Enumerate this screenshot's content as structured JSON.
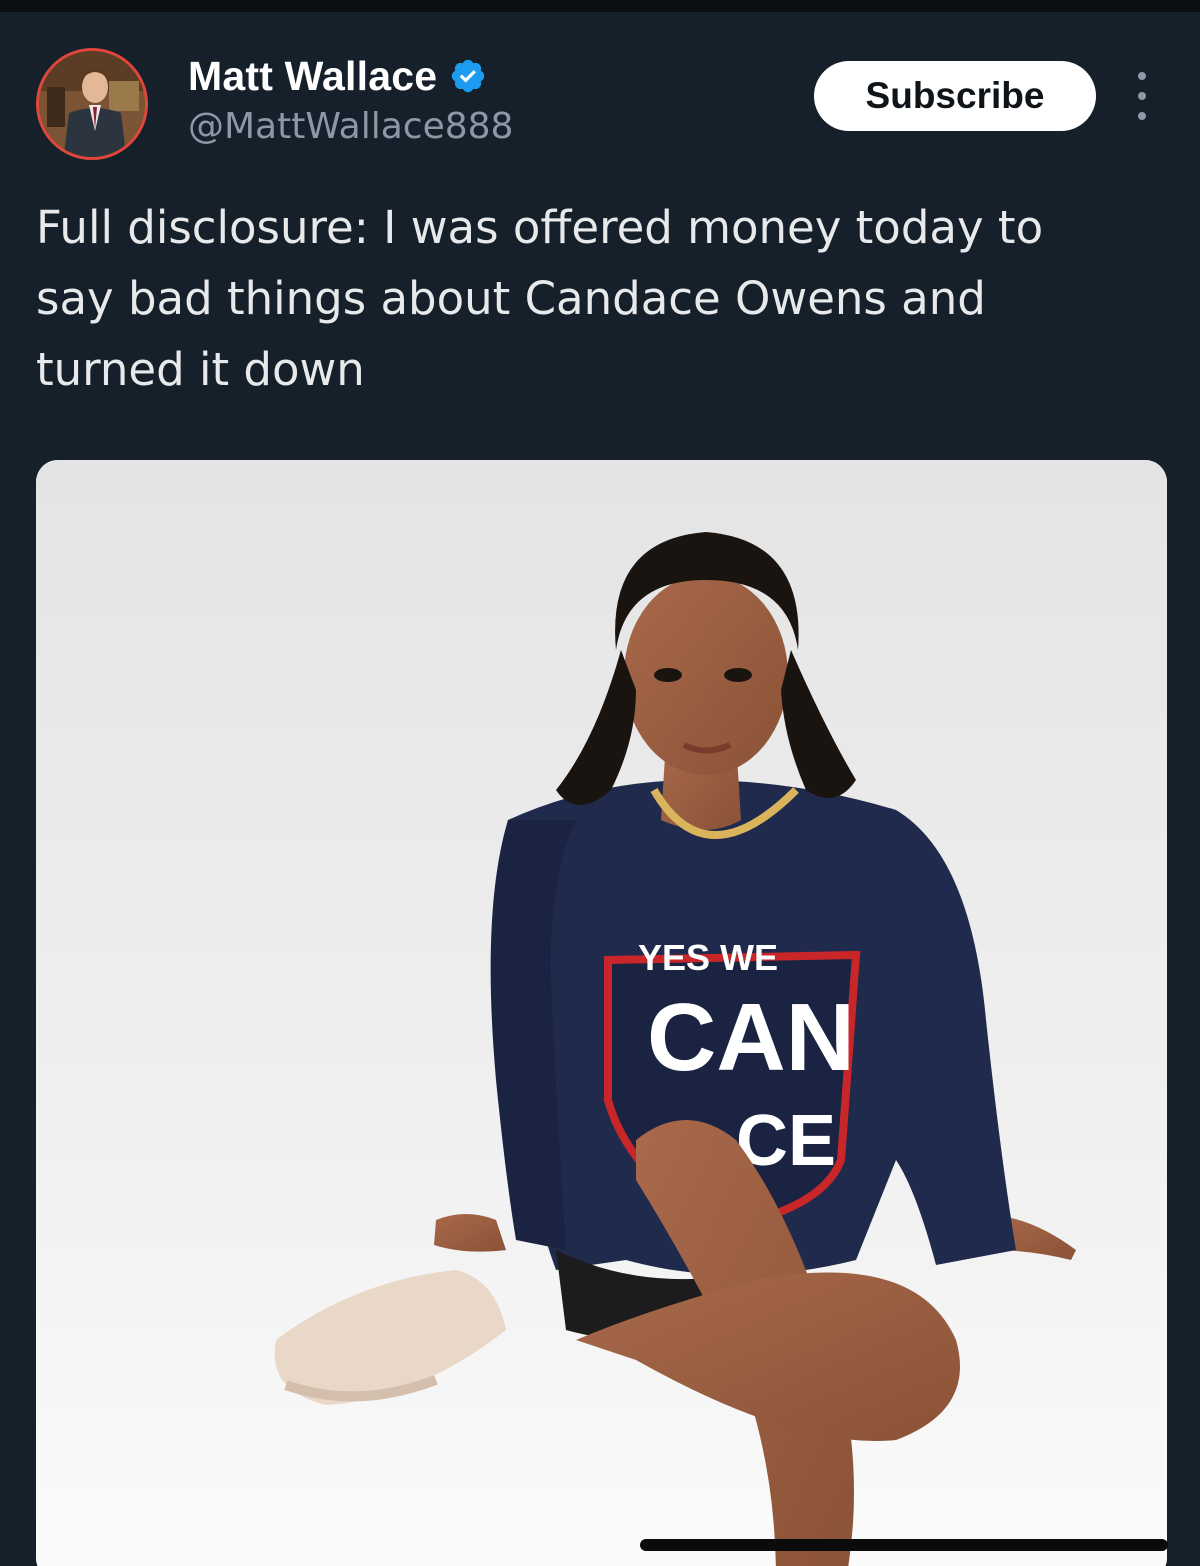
{
  "tweet": {
    "author": {
      "display_name": "Matt Wallace",
      "handle": "@MattWallace888",
      "verified": true,
      "avatar_icon": "profile-photo-avatar"
    },
    "subscribe_label": "Subscribe",
    "more_icon": "more-vertical-icon",
    "text": "Full disclosure: I was offered money today to\nsay bad things about Candace Owens and\nturned it down",
    "media": {
      "shirt_text": {
        "line1": "YES WE",
        "line2": "CAN",
        "line3": "CE"
      }
    }
  },
  "colors": {
    "background": "#15202b",
    "text": "#e7e9ea",
    "secondary_text": "#8b98a5",
    "verified_badge": "#1d9bf0",
    "avatar_ring": "#e0463b"
  }
}
